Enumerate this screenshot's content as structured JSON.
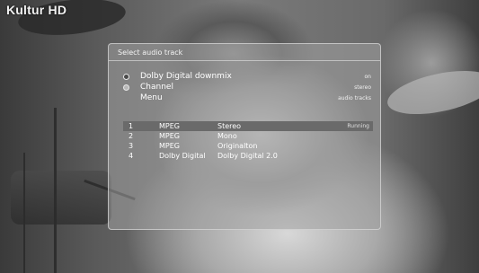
{
  "channel": {
    "logo": "Kultur HD"
  },
  "dialog": {
    "title": "Select audio track",
    "options": [
      {
        "icon": "red-circle-icon",
        "label": "Dolby Digital downmix",
        "value": "on"
      },
      {
        "icon": "green-circle-icon",
        "label": "Channel",
        "value": "stereo"
      },
      {
        "icon": "none",
        "label": "Menu",
        "value": "audio tracks"
      }
    ],
    "tracks": [
      {
        "number": "1",
        "codec": "MPEG",
        "name": "Stereo",
        "status": "Running",
        "selected": true
      },
      {
        "number": "2",
        "codec": "MPEG",
        "name": "Mono",
        "status": "",
        "selected": false
      },
      {
        "number": "3",
        "codec": "MPEG",
        "name": "Originalton",
        "status": "",
        "selected": false
      },
      {
        "number": "4",
        "codec": "Dolby Digital",
        "name": "Dolby Digital 2.0",
        "status": "",
        "selected": false
      }
    ]
  }
}
